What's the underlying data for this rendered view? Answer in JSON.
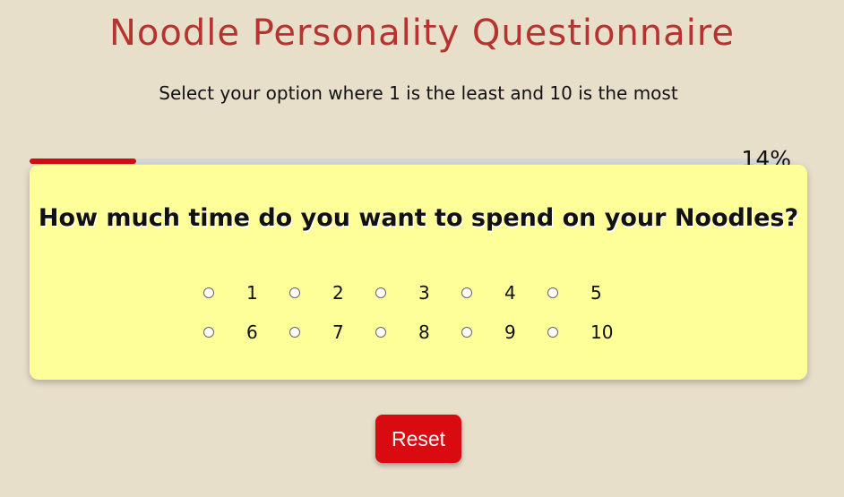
{
  "header": {
    "title": "Noodle Personality Questionnaire",
    "subtitle": "Select your option where 1 is the least and 10 is the most"
  },
  "progress": {
    "value": 0.14,
    "label": "14%"
  },
  "question": {
    "text": "How much time do you want to spend on your Noodles?",
    "options_row1": [
      "1",
      "2",
      "3",
      "4",
      "5"
    ],
    "options_row2": [
      "6",
      "7",
      "8",
      "9",
      "10"
    ]
  },
  "controls": {
    "reset_label": "Reset"
  },
  "colors": {
    "background": "#e8dfcb",
    "title": "#b5342f",
    "card": "#ffff99",
    "accent": "#d90b10"
  }
}
